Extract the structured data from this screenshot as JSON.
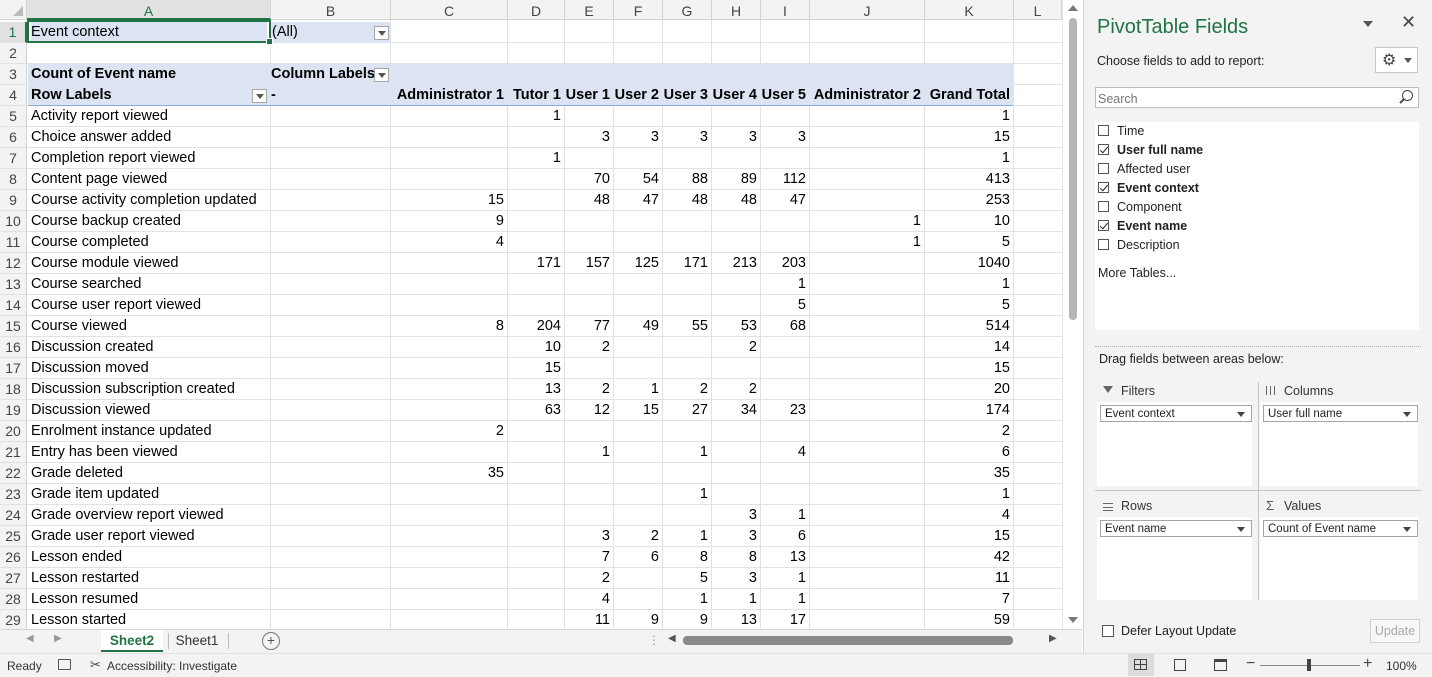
{
  "columns": [
    "A",
    "B",
    "C",
    "D",
    "E",
    "F",
    "G",
    "H",
    "I",
    "J",
    "K",
    "L"
  ],
  "filter_row": {
    "label": "Event context",
    "value": "(All)"
  },
  "pivot_header": {
    "measure": "Count of Event name",
    "column_labels": "Column Labels",
    "row_labels": "Row Labels",
    "dash": "-",
    "users": [
      "Administrator 1",
      "Tutor 1",
      "User 1",
      "User 2",
      "User 3",
      "User 4",
      "User 5",
      "Administrator 2",
      "Grand Total"
    ]
  },
  "rows": [
    {
      "n": "5",
      "label": "Activity report viewed",
      "v": [
        "",
        "1",
        "",
        "",
        "",
        "",
        "",
        "",
        "1"
      ]
    },
    {
      "n": "6",
      "label": "Choice answer added",
      "v": [
        "",
        "",
        "3",
        "3",
        "3",
        "3",
        "3",
        "",
        "15"
      ]
    },
    {
      "n": "7",
      "label": "Completion report viewed",
      "v": [
        "",
        "1",
        "",
        "",
        "",
        "",
        "",
        "",
        "1"
      ]
    },
    {
      "n": "8",
      "label": "Content page viewed",
      "v": [
        "",
        "",
        "70",
        "54",
        "88",
        "89",
        "112",
        "",
        "413"
      ]
    },
    {
      "n": "9",
      "label": "Course activity completion updated",
      "v": [
        "15",
        "",
        "48",
        "47",
        "48",
        "48",
        "47",
        "",
        "253"
      ]
    },
    {
      "n": "10",
      "label": "Course backup created",
      "v": [
        "9",
        "",
        "",
        "",
        "",
        "",
        "",
        "1",
        "10"
      ]
    },
    {
      "n": "11",
      "label": "Course completed",
      "v": [
        "4",
        "",
        "",
        "",
        "",
        "",
        "",
        "1",
        "5"
      ]
    },
    {
      "n": "12",
      "label": "Course module viewed",
      "v": [
        "",
        "171",
        "157",
        "125",
        "171",
        "213",
        "203",
        "",
        "1040"
      ]
    },
    {
      "n": "13",
      "label": "Course searched",
      "v": [
        "",
        "",
        "",
        "",
        "",
        "",
        "1",
        "",
        "1"
      ]
    },
    {
      "n": "14",
      "label": "Course user report viewed",
      "v": [
        "",
        "",
        "",
        "",
        "",
        "",
        "5",
        "",
        "5"
      ]
    },
    {
      "n": "15",
      "label": "Course viewed",
      "v": [
        "8",
        "204",
        "77",
        "49",
        "55",
        "53",
        "68",
        "",
        "514"
      ]
    },
    {
      "n": "16",
      "label": "Discussion created",
      "v": [
        "",
        "10",
        "2",
        "",
        "",
        "2",
        "",
        "",
        "14"
      ]
    },
    {
      "n": "17",
      "label": "Discussion moved",
      "v": [
        "",
        "15",
        "",
        "",
        "",
        "",
        "",
        "",
        "15"
      ]
    },
    {
      "n": "18",
      "label": "Discussion subscription created",
      "v": [
        "",
        "13",
        "2",
        "1",
        "2",
        "2",
        "",
        "",
        "20"
      ]
    },
    {
      "n": "19",
      "label": "Discussion viewed",
      "v": [
        "",
        "63",
        "12",
        "15",
        "27",
        "34",
        "23",
        "",
        "174"
      ]
    },
    {
      "n": "20",
      "label": "Enrolment instance updated",
      "v": [
        "2",
        "",
        "",
        "",
        "",
        "",
        "",
        "",
        "2"
      ]
    },
    {
      "n": "21",
      "label": "Entry has been viewed",
      "v": [
        "",
        "",
        "1",
        "",
        "1",
        "",
        "4",
        "",
        "6"
      ]
    },
    {
      "n": "22",
      "label": "Grade deleted",
      "v": [
        "35",
        "",
        "",
        "",
        "",
        "",
        "",
        "",
        "35"
      ]
    },
    {
      "n": "23",
      "label": "Grade item updated",
      "v": [
        "",
        "",
        "",
        "",
        "1",
        "",
        "",
        "",
        "1"
      ]
    },
    {
      "n": "24",
      "label": "Grade overview report viewed",
      "v": [
        "",
        "",
        "",
        "",
        "",
        "3",
        "1",
        "",
        "4"
      ]
    },
    {
      "n": "25",
      "label": "Grade user report viewed",
      "v": [
        "",
        "",
        "3",
        "2",
        "1",
        "3",
        "6",
        "",
        "15"
      ]
    },
    {
      "n": "26",
      "label": "Lesson ended",
      "v": [
        "",
        "",
        "7",
        "6",
        "8",
        "8",
        "13",
        "",
        "42"
      ]
    },
    {
      "n": "27",
      "label": "Lesson restarted",
      "v": [
        "",
        "",
        "2",
        "",
        "5",
        "3",
        "1",
        "",
        "11"
      ]
    },
    {
      "n": "28",
      "label": "Lesson resumed",
      "v": [
        "",
        "",
        "4",
        "",
        "1",
        "1",
        "1",
        "",
        "7"
      ]
    },
    {
      "n": "29",
      "label": "Lesson started",
      "v": [
        "",
        "",
        "11",
        "9",
        "9",
        "13",
        "17",
        "",
        "59"
      ]
    }
  ],
  "sheets": {
    "active": "Sheet2",
    "other": "Sheet1",
    "add_symbol": "+"
  },
  "status": {
    "ready": "Ready",
    "accessibility": "Accessibility: Investigate",
    "zoom": "100%"
  },
  "pane": {
    "title": "PivotTable Fields",
    "choose": "Choose fields to add to report:",
    "search_placeholder": "Search",
    "fields": [
      {
        "name": "Time",
        "checked": false
      },
      {
        "name": "User full name",
        "checked": true
      },
      {
        "name": "Affected user",
        "checked": false
      },
      {
        "name": "Event context",
        "checked": true
      },
      {
        "name": "Component",
        "checked": false
      },
      {
        "name": "Event name",
        "checked": true
      },
      {
        "name": "Description",
        "checked": false
      }
    ],
    "more_tables": "More Tables...",
    "drag_text": "Drag fields between areas below:",
    "areas": {
      "filters": {
        "title": "Filters",
        "field": "Event context"
      },
      "columns": {
        "title": "Columns",
        "field": "User full name"
      },
      "rows": {
        "title": "Rows",
        "field": "Event name"
      },
      "values": {
        "title": "Values",
        "field": "Count of Event name"
      }
    },
    "defer": "Defer Layout Update",
    "update": "Update"
  }
}
